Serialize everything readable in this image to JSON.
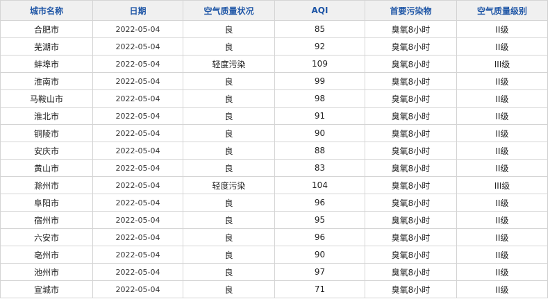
{
  "table": {
    "headers": [
      "城市名称",
      "日期",
      "空气质量状况",
      "AQI",
      "首要污染物",
      "空气质量级别"
    ],
    "rows": [
      [
        "合肥市",
        "2022-05-04",
        "良",
        "85",
        "臭氧8小时",
        "II级"
      ],
      [
        "芜湖市",
        "2022-05-04",
        "良",
        "92",
        "臭氧8小时",
        "II级"
      ],
      [
        "蚌埠市",
        "2022-05-04",
        "轻度污染",
        "109",
        "臭氧8小时",
        "III级"
      ],
      [
        "淮南市",
        "2022-05-04",
        "良",
        "99",
        "臭氧8小时",
        "II级"
      ],
      [
        "马鞍山市",
        "2022-05-04",
        "良",
        "98",
        "臭氧8小时",
        "II级"
      ],
      [
        "淮北市",
        "2022-05-04",
        "良",
        "91",
        "臭氧8小时",
        "II级"
      ],
      [
        "铜陵市",
        "2022-05-04",
        "良",
        "90",
        "臭氧8小时",
        "II级"
      ],
      [
        "安庆市",
        "2022-05-04",
        "良",
        "88",
        "臭氧8小时",
        "II级"
      ],
      [
        "黄山市",
        "2022-05-04",
        "良",
        "83",
        "臭氧8小时",
        "II级"
      ],
      [
        "滁州市",
        "2022-05-04",
        "轻度污染",
        "104",
        "臭氧8小时",
        "III级"
      ],
      [
        "阜阳市",
        "2022-05-04",
        "良",
        "96",
        "臭氧8小时",
        "II级"
      ],
      [
        "宿州市",
        "2022-05-04",
        "良",
        "95",
        "臭氧8小时",
        "II级"
      ],
      [
        "六安市",
        "2022-05-04",
        "良",
        "96",
        "臭氧8小时",
        "II级"
      ],
      [
        "亳州市",
        "2022-05-04",
        "良",
        "90",
        "臭氧8小时",
        "II级"
      ],
      [
        "池州市",
        "2022-05-04",
        "良",
        "97",
        "臭氧8小时",
        "II级"
      ],
      [
        "宣城市",
        "2022-05-04",
        "良",
        "71",
        "臭氧8小时",
        "II级"
      ]
    ]
  },
  "colors": {
    "header_text": "#1f56a6",
    "header_bg": "#f0f0f0",
    "border": "#d4d4d4"
  }
}
